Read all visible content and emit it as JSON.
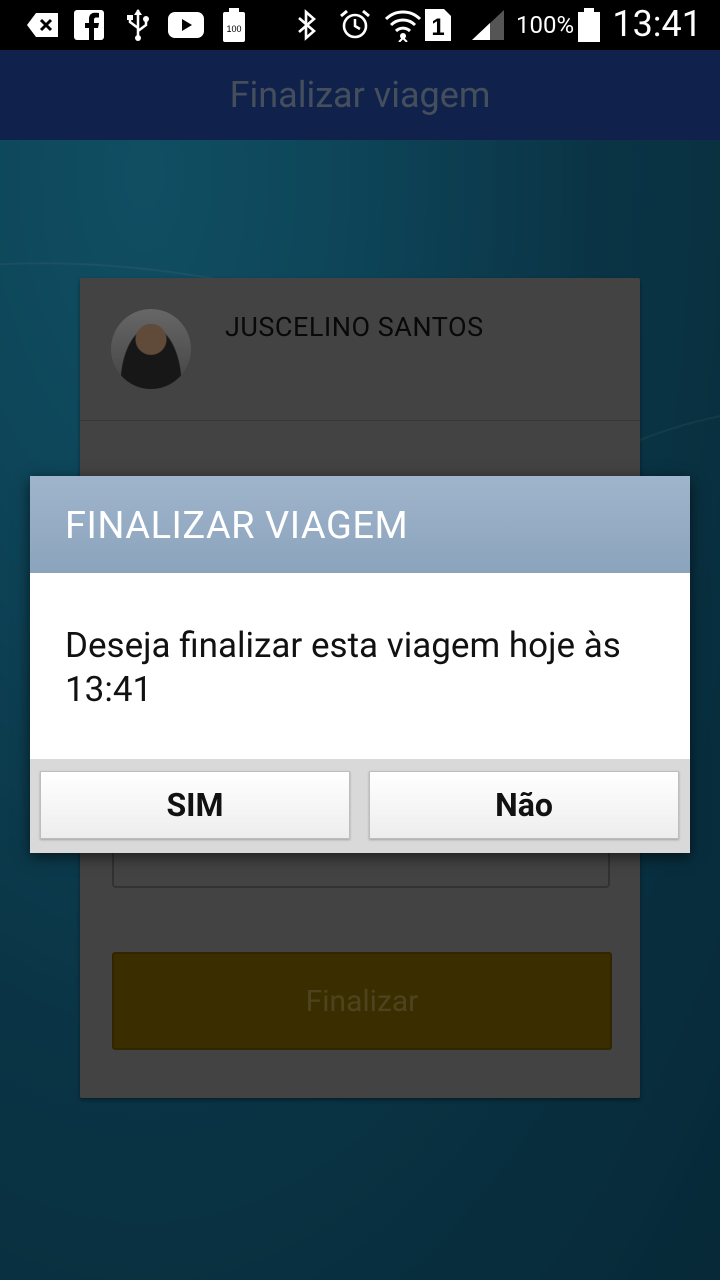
{
  "status_bar": {
    "battery_percent": "100%",
    "time": "13:41",
    "notification_badge": "1"
  },
  "app": {
    "title": "Finalizar viagem"
  },
  "card": {
    "driver_name": "JUSCELINO SANTOS",
    "finalize_label": "Finalizar"
  },
  "dialog": {
    "title": "FINALIZAR VIAGEM",
    "message": "Deseja finalizar esta viagem hoje às 13:41",
    "confirm_label": "SIM",
    "cancel_label": "Não"
  }
}
